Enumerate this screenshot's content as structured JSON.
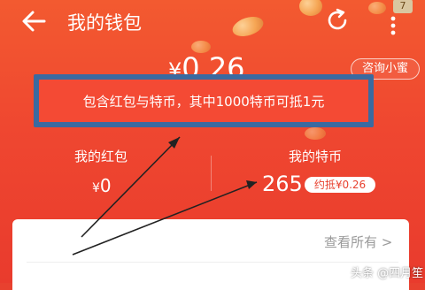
{
  "header": {
    "title": "我的钱包",
    "badge_count": "7",
    "icons": [
      "arrow-left-icon",
      "refresh-icon",
      "more-vertical-icon"
    ]
  },
  "balance": {
    "currency": "¥",
    "amount": "0.26"
  },
  "consult_button": "咨询小蜜",
  "notice": "包含红包与特币，其中1000特币可抵1元",
  "red_packet": {
    "label": "我的红包",
    "currency": "¥",
    "value": "0"
  },
  "coins": {
    "label": "我的特币",
    "value": "265",
    "approx": "约抵¥0.26"
  },
  "card": {
    "view_all": "查看所有 >"
  },
  "watermark": "头条 @四月笙",
  "colors": {
    "background": "#ef4730",
    "highlight_border": "#3b6aa0",
    "text": "#ffffff"
  }
}
